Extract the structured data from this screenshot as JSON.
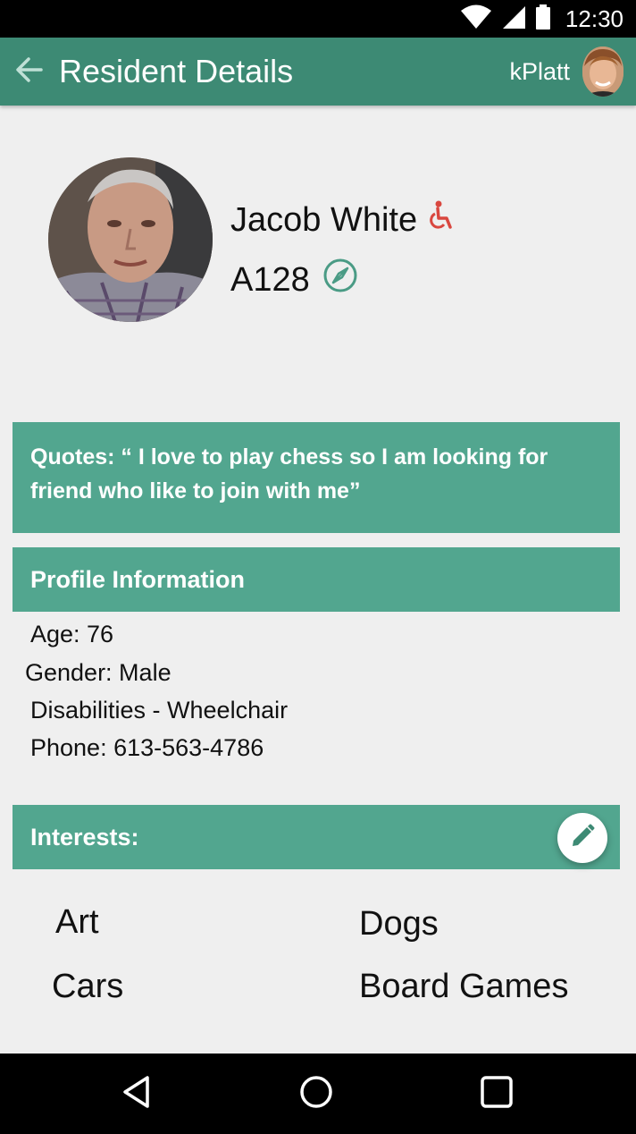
{
  "status_bar": {
    "time": "12:30",
    "icons": [
      "wifi-icon",
      "signal-icon",
      "battery-icon"
    ]
  },
  "app_bar": {
    "title": "Resident Details",
    "username": "kPlatt",
    "color": "#3d8a74"
  },
  "resident": {
    "name": "Jacob White",
    "room": "A128",
    "name_icon": "wheelchair-icon",
    "room_icon": "compass-icon"
  },
  "quote": {
    "line1": "Quotes: “ I love to play chess so I am looking for",
    "line2": "friend who like to join with me”"
  },
  "profile_info": {
    "header": "Profile Information",
    "age": "Age: 76",
    "gender": "Gender: Male",
    "disabilities": "Disabilities - Wheelchair",
    "phone": "Phone: 613-563-4786"
  },
  "interests": {
    "header": "Interests:",
    "items": [
      "Art",
      "Dogs",
      "Cars",
      "Board Games"
    ]
  },
  "colors": {
    "accent": "#52a68f",
    "wheelchair": "#d9473f",
    "compass": "#4a9b85"
  }
}
